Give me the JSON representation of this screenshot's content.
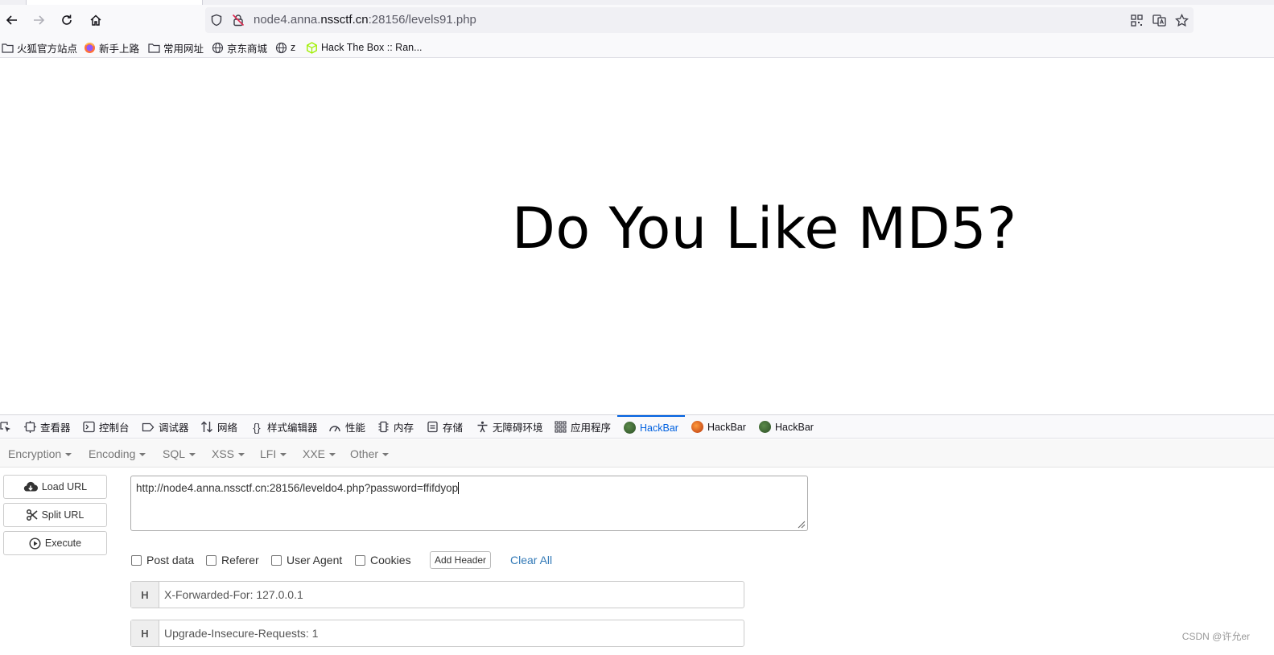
{
  "browser": {
    "url_prefix": "node4.anna.",
    "url_domain": "nssctf.cn",
    "url_suffix": ":28156/levels91.php",
    "bookmarks": [
      {
        "label": "火狐官方站点",
        "icon": "folder-icon"
      },
      {
        "label": "新手上路",
        "icon": "firefox-icon"
      },
      {
        "label": "常用网址",
        "icon": "folder-icon"
      },
      {
        "label": "京东商城",
        "icon": "globe-icon"
      },
      {
        "label": "z",
        "icon": "globe-icon"
      },
      {
        "label": "Hack The Box :: Ran...",
        "icon": "hackthebox-icon"
      }
    ]
  },
  "page": {
    "heading": "Do You Like MD5?"
  },
  "devtools": {
    "tabs": [
      {
        "label": "查看器",
        "icon": "inspector-icon"
      },
      {
        "label": "控制台",
        "icon": "console-icon"
      },
      {
        "label": "调试器",
        "icon": "debugger-icon"
      },
      {
        "label": "网络",
        "icon": "network-icon"
      },
      {
        "label": "样式编辑器",
        "icon": "style-editor-icon"
      },
      {
        "label": "性能",
        "icon": "performance-icon"
      },
      {
        "label": "内存",
        "icon": "memory-icon"
      },
      {
        "label": "存储",
        "icon": "storage-icon"
      },
      {
        "label": "无障碍环境",
        "icon": "accessibility-icon"
      },
      {
        "label": "应用程序",
        "icon": "application-icon"
      },
      {
        "label": "HackBar",
        "icon": "hackbar-icon",
        "active": true
      },
      {
        "label": "HackBar",
        "icon": "hackbar-orange-icon"
      },
      {
        "label": "HackBar",
        "icon": "hackbar-icon"
      }
    ]
  },
  "hackbar": {
    "menu": [
      "Encryption",
      "Encoding",
      "SQL",
      "XSS",
      "LFI",
      "XXE",
      "Other"
    ],
    "buttons": {
      "load_url": "Load URL",
      "split_url": "Split URL",
      "execute": "Execute"
    },
    "url_value": "http://node4.anna.nssctf.cn:28156/leveldo4.php?password=ffifdyop",
    "options": {
      "post_data": "Post data",
      "referer": "Referer",
      "user_agent": "User Agent",
      "cookies": "Cookies"
    },
    "add_header": "Add Header",
    "clear_all": "Clear All",
    "headers": [
      {
        "tag": "H",
        "value": "X-Forwarded-For: 127.0.0.1"
      },
      {
        "tag": "H",
        "value": "Upgrade-Insecure-Requests: 1"
      }
    ],
    "colors": {
      "link": "#337ab7",
      "active_tab": "#0061e0"
    }
  },
  "watermark": "CSDN @许允er"
}
